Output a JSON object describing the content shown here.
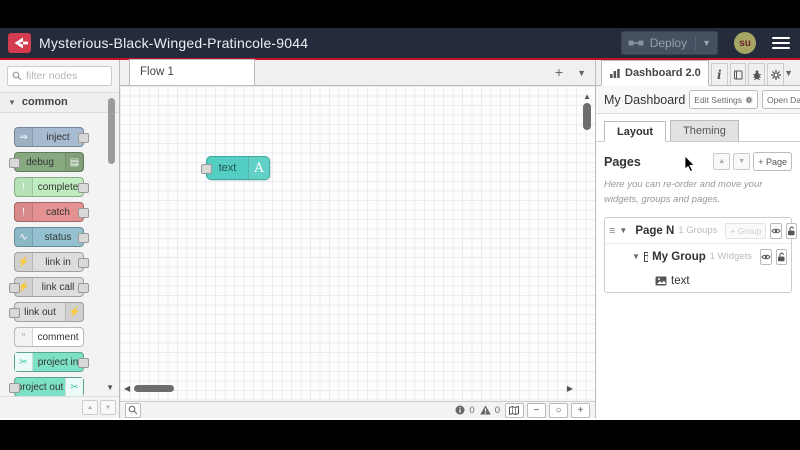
{
  "header": {
    "title": "Mysterious-Black-Winged-Pratincole-9044",
    "deploy_label": "Deploy",
    "user_initials": "su"
  },
  "colors": {
    "accent_red": "#c3112d",
    "header_bg": "#242c3c",
    "flow_node_teal": "#54cdc2"
  },
  "palette": {
    "filter_placeholder": "filter nodes",
    "category_label": "common",
    "nodes": [
      {
        "label": "inject",
        "icon": "inject-icon",
        "glyph": "⇒",
        "color": "#a6bbcf",
        "ports": "right",
        "icon_side": "left"
      },
      {
        "label": "debug",
        "icon": "debug-icon",
        "glyph": "▤",
        "color": "#87a980",
        "ports": "left",
        "icon_side": "right"
      },
      {
        "label": "complete",
        "icon": "complete-icon",
        "glyph": "!",
        "color": "#c0edc0",
        "ports": "right",
        "icon_side": "left"
      },
      {
        "label": "catch",
        "icon": "catch-icon",
        "glyph": "!",
        "color": "#e49191",
        "ports": "right",
        "icon_side": "left"
      },
      {
        "label": "status",
        "icon": "status-icon",
        "glyph": "∿",
        "color": "#94c1d0",
        "ports": "right",
        "icon_side": "left"
      },
      {
        "label": "link in",
        "icon": "link-in-icon",
        "glyph": "⚡",
        "color": "#dddddd",
        "ports": "right",
        "icon_side": "left"
      },
      {
        "label": "link call",
        "icon": "link-call-icon",
        "glyph": "⚡",
        "color": "#dddddd",
        "ports": "both",
        "icon_side": "left"
      },
      {
        "label": "link out",
        "icon": "link-out-icon",
        "glyph": "⚡",
        "color": "#dddddd",
        "ports": "left",
        "icon_side": "right"
      },
      {
        "label": "comment",
        "icon": "comment-icon",
        "glyph": "“",
        "glyph_color": "#999999",
        "color": "#ffffff",
        "ports": "none",
        "icon_side": "left"
      },
      {
        "label": "project in",
        "icon": "project-in-icon",
        "glyph": "✂",
        "glyph_color": "#45c3a8",
        "chip": true,
        "color": "#7de1c6",
        "ports": "right",
        "icon_side": "left"
      },
      {
        "label": "project out",
        "icon": "project-out-icon",
        "glyph": "✂",
        "glyph_color": "#45c3a8",
        "chip": true,
        "color": "#7de1c6",
        "ports": "left",
        "icon_side": "right"
      }
    ]
  },
  "workspace": {
    "tab_label": "Flow 1",
    "flow_node": {
      "label": "text",
      "icon_letter": "A"
    },
    "footer": {
      "error_count": "0",
      "warning_count": "0"
    }
  },
  "sidebar": {
    "active_tab": "Dashboard 2.0",
    "dashboard_title": "My Dashboard",
    "edit_settings_label": "Edit Settings",
    "open_dashboard_label": "Open Dashboard",
    "layout_tab": "Layout",
    "theming_tab": "Theming",
    "pages_title": "Pages",
    "add_page_label": "+ Page",
    "description": "Here you can re-order and move your widgets, groups and pages.",
    "tree": {
      "page_name": "Page N",
      "page_meta": "1 Groups",
      "add_group_label": "+ Group",
      "group_name": "My Group",
      "group_meta": "1 Widgets",
      "widget_name": "text"
    }
  }
}
